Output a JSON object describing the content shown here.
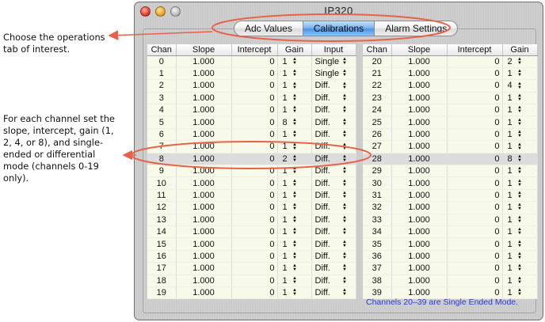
{
  "annotations": {
    "tab_note": "Choose the operations tab of interest.",
    "row_note": "For each channel set the slope, intercept, gain (1, 2, 4, or 8), and single-ended or differential mode (channels 0-19 only)."
  },
  "window": {
    "title": "IP320"
  },
  "tabs": [
    {
      "label": "Adc Values",
      "active": false
    },
    {
      "label": "Calibrations",
      "active": true
    },
    {
      "label": "Alarm Settings",
      "active": false
    }
  ],
  "left_table": {
    "headers": [
      "Chan",
      "Slope",
      "Intercept",
      "Gain",
      "Input"
    ],
    "rows": [
      {
        "chan": "0",
        "slope": "1.000",
        "intercept": "0",
        "gain": "1",
        "input": "Single"
      },
      {
        "chan": "1",
        "slope": "1.000",
        "intercept": "0",
        "gain": "1",
        "input": "Single"
      },
      {
        "chan": "2",
        "slope": "1.000",
        "intercept": "0",
        "gain": "1",
        "input": "Diff."
      },
      {
        "chan": "3",
        "slope": "1.000",
        "intercept": "0",
        "gain": "1",
        "input": "Diff."
      },
      {
        "chan": "4",
        "slope": "1.000",
        "intercept": "0",
        "gain": "1",
        "input": "Diff."
      },
      {
        "chan": "5",
        "slope": "1.000",
        "intercept": "0",
        "gain": "8",
        "input": "Diff."
      },
      {
        "chan": "6",
        "slope": "1.000",
        "intercept": "0",
        "gain": "1",
        "input": "Diff."
      },
      {
        "chan": "7",
        "slope": "1.000",
        "intercept": "0",
        "gain": "1",
        "input": "Diff."
      },
      {
        "chan": "8",
        "slope": "1.000",
        "intercept": "0",
        "gain": "2",
        "input": "Diff.",
        "selected": true
      },
      {
        "chan": "9",
        "slope": "1.000",
        "intercept": "0",
        "gain": "1",
        "input": "Diff."
      },
      {
        "chan": "10",
        "slope": "1.000",
        "intercept": "0",
        "gain": "1",
        "input": "Diff."
      },
      {
        "chan": "11",
        "slope": "1.000",
        "intercept": "0",
        "gain": "1",
        "input": "Diff."
      },
      {
        "chan": "12",
        "slope": "1.000",
        "intercept": "0",
        "gain": "1",
        "input": "Diff."
      },
      {
        "chan": "13",
        "slope": "1.000",
        "intercept": "0",
        "gain": "1",
        "input": "Diff."
      },
      {
        "chan": "14",
        "slope": "1.000",
        "intercept": "0",
        "gain": "1",
        "input": "Diff."
      },
      {
        "chan": "15",
        "slope": "1.000",
        "intercept": "0",
        "gain": "1",
        "input": "Diff."
      },
      {
        "chan": "16",
        "slope": "1.000",
        "intercept": "0",
        "gain": "1",
        "input": "Diff."
      },
      {
        "chan": "17",
        "slope": "1.000",
        "intercept": "0",
        "gain": "1",
        "input": "Diff."
      },
      {
        "chan": "18",
        "slope": "1.000",
        "intercept": "0",
        "gain": "1",
        "input": "Diff."
      },
      {
        "chan": "19",
        "slope": "1.000",
        "intercept": "0",
        "gain": "1",
        "input": "Diff."
      }
    ]
  },
  "right_table": {
    "headers": [
      "Chan",
      "Slope",
      "Intercept",
      "Gain"
    ],
    "rows": [
      {
        "chan": "20",
        "slope": "1.000",
        "intercept": "0",
        "gain": "2"
      },
      {
        "chan": "21",
        "slope": "1.000",
        "intercept": "0",
        "gain": "1"
      },
      {
        "chan": "22",
        "slope": "1.000",
        "intercept": "0",
        "gain": "4"
      },
      {
        "chan": "23",
        "slope": "1.000",
        "intercept": "0",
        "gain": "1"
      },
      {
        "chan": "24",
        "slope": "1.000",
        "intercept": "0",
        "gain": "1"
      },
      {
        "chan": "25",
        "slope": "1.000",
        "intercept": "0",
        "gain": "1"
      },
      {
        "chan": "26",
        "slope": "1.000",
        "intercept": "0",
        "gain": "1"
      },
      {
        "chan": "27",
        "slope": "1.000",
        "intercept": "0",
        "gain": "1"
      },
      {
        "chan": "28",
        "slope": "1.000",
        "intercept": "0",
        "gain": "8",
        "selected": true
      },
      {
        "chan": "29",
        "slope": "1.000",
        "intercept": "0",
        "gain": "1"
      },
      {
        "chan": "30",
        "slope": "1.000",
        "intercept": "0",
        "gain": "1"
      },
      {
        "chan": "31",
        "slope": "1.000",
        "intercept": "0",
        "gain": "1"
      },
      {
        "chan": "32",
        "slope": "1.000",
        "intercept": "0",
        "gain": "1"
      },
      {
        "chan": "33",
        "slope": "1.000",
        "intercept": "0",
        "gain": "1"
      },
      {
        "chan": "34",
        "slope": "1.000",
        "intercept": "0",
        "gain": "1"
      },
      {
        "chan": "35",
        "slope": "1.000",
        "intercept": "0",
        "gain": "1"
      },
      {
        "chan": "36",
        "slope": "1.000",
        "intercept": "0",
        "gain": "1"
      },
      {
        "chan": "37",
        "slope": "1.000",
        "intercept": "0",
        "gain": "1"
      },
      {
        "chan": "38",
        "slope": "1.000",
        "intercept": "0",
        "gain": "1"
      },
      {
        "chan": "39",
        "slope": "1.000",
        "intercept": "0",
        "gain": "1"
      }
    ]
  },
  "footnote": "Channels 20–39 are Single Ended Mode.",
  "colors": {
    "annotation": "#e8624a",
    "footnote": "#2b3bd0",
    "active_tab": "#5a9ee6"
  },
  "icons": {
    "stepper": "up-down-arrows-icon",
    "window_buttons": [
      "close-icon",
      "minimize-icon",
      "zoom-icon"
    ]
  }
}
